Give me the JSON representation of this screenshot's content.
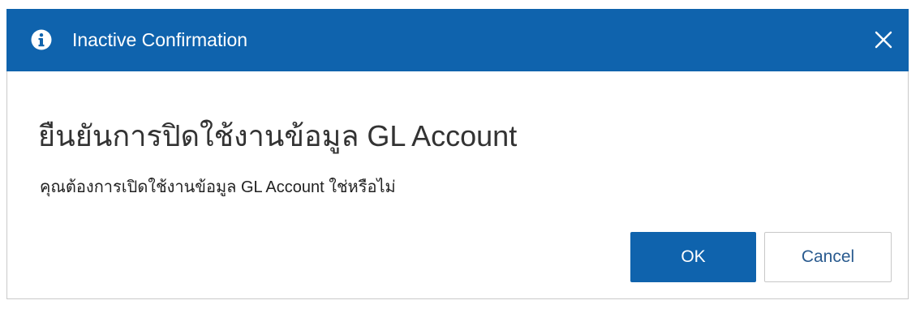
{
  "dialog": {
    "title": "Inactive Confirmation",
    "icon": "info-circle-icon",
    "close_icon": "close-icon",
    "heading": "ยืนยันการปิดใช้งานข้อมูล GL Account",
    "message": "คุณต้องการเปิดใช้งานข้อมูล GL Account ใช่หรือไม่",
    "ok_label": "OK",
    "cancel_label": "Cancel"
  },
  "colors": {
    "header_bg": "#0f63ad",
    "primary_button": "#0f63ad",
    "cancel_text": "#2a5b8f"
  }
}
